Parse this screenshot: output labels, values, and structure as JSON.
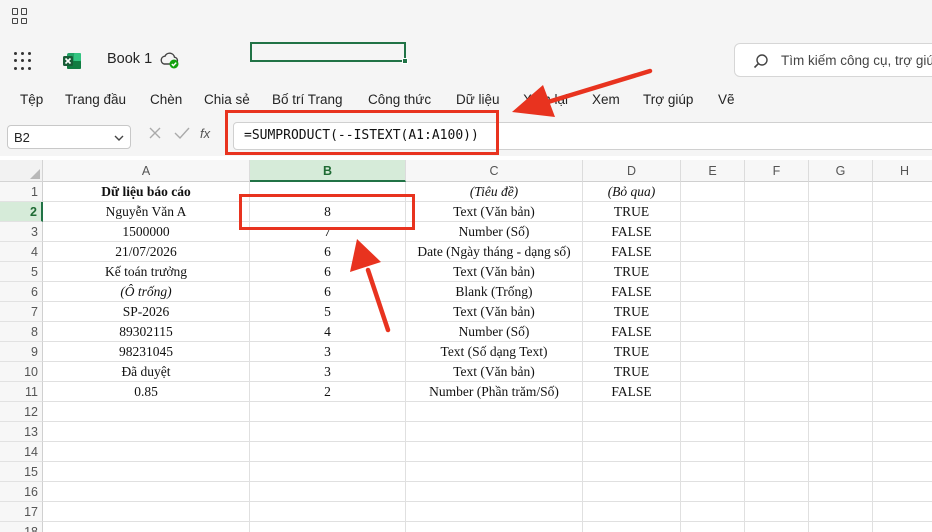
{
  "app": {
    "title": "Book 1"
  },
  "search": {
    "placeholder": "Tìm kiếm công cụ, trợ giú"
  },
  "ribbon": {
    "tabs": [
      "Tệp",
      "Trang đầu",
      "Chèn",
      "Chia sẻ",
      "Bố trí Trang",
      "Công thức",
      "Dữ liệu",
      "Xem lại",
      "Xem",
      "Trợ giúp",
      "Vẽ"
    ]
  },
  "formula_bar": {
    "name_box": "B2",
    "fx_label": "fx",
    "formula": "=SUMPRODUCT(--ISTEXT(A1:A100))"
  },
  "sheet": {
    "columns": [
      "A",
      "B",
      "C",
      "D",
      "E",
      "F",
      "G",
      "H"
    ],
    "selected_cell": "B2",
    "rows": [
      {
        "n": "1",
        "a": "Dữ liệu báo cáo",
        "b": "",
        "c": "(Tiêu đề)",
        "d": "(Bỏ qua)"
      },
      {
        "n": "2",
        "a": "Nguyễn Văn A",
        "b": "8",
        "c": "Text (Văn bản)",
        "d": "TRUE"
      },
      {
        "n": "3",
        "a": "1500000",
        "b": "7",
        "c": "Number (Số)",
        "d": "FALSE"
      },
      {
        "n": "4",
        "a": "21/07/2026",
        "b": "6",
        "c": "Date (Ngày tháng - dạng số)",
        "d": "FALSE"
      },
      {
        "n": "5",
        "a": "Kế toán trưởng",
        "b": "6",
        "c": "Text (Văn bản)",
        "d": "TRUE"
      },
      {
        "n": "6",
        "a": "(Ô trống)",
        "b": "6",
        "c": "Blank (Trống)",
        "d": "FALSE"
      },
      {
        "n": "7",
        "a": "SP-2026",
        "b": "5",
        "c": "Text (Văn bản)",
        "d": "TRUE"
      },
      {
        "n": "8",
        "a": "89302115",
        "b": "4",
        "c": "Number (Số)",
        "d": "FALSE"
      },
      {
        "n": "9",
        "a": "98231045",
        "b": "3",
        "c": "Text (Số dạng Text)",
        "d": "TRUE"
      },
      {
        "n": "10",
        "a": "Đã duyệt",
        "b": "3",
        "c": "Text (Văn bản)",
        "d": "TRUE"
      },
      {
        "n": "11",
        "a": "0.85",
        "b": "2",
        "c": "Number (Phần trăm/Số)",
        "d": "FALSE"
      },
      {
        "n": "12",
        "a": "",
        "b": "",
        "c": "",
        "d": ""
      },
      {
        "n": "13",
        "a": "",
        "b": "",
        "c": "",
        "d": ""
      },
      {
        "n": "14",
        "a": "",
        "b": "",
        "c": "",
        "d": ""
      },
      {
        "n": "15",
        "a": "",
        "b": "",
        "c": "",
        "d": ""
      },
      {
        "n": "16",
        "a": "",
        "b": "",
        "c": "",
        "d": ""
      },
      {
        "n": "17",
        "a": "",
        "b": "",
        "c": "",
        "d": ""
      },
      {
        "n": "18",
        "a": "",
        "b": "",
        "c": "",
        "d": ""
      }
    ]
  },
  "colors": {
    "accent": "#217346",
    "annotation": "#e8331f"
  },
  "icons": [
    "app-grid-icon",
    "waffle-icon",
    "excel-logo-icon",
    "cloud-saved-icon",
    "search-icon",
    "chevron-down-icon",
    "cancel-icon",
    "confirm-icon",
    "function-icon"
  ]
}
